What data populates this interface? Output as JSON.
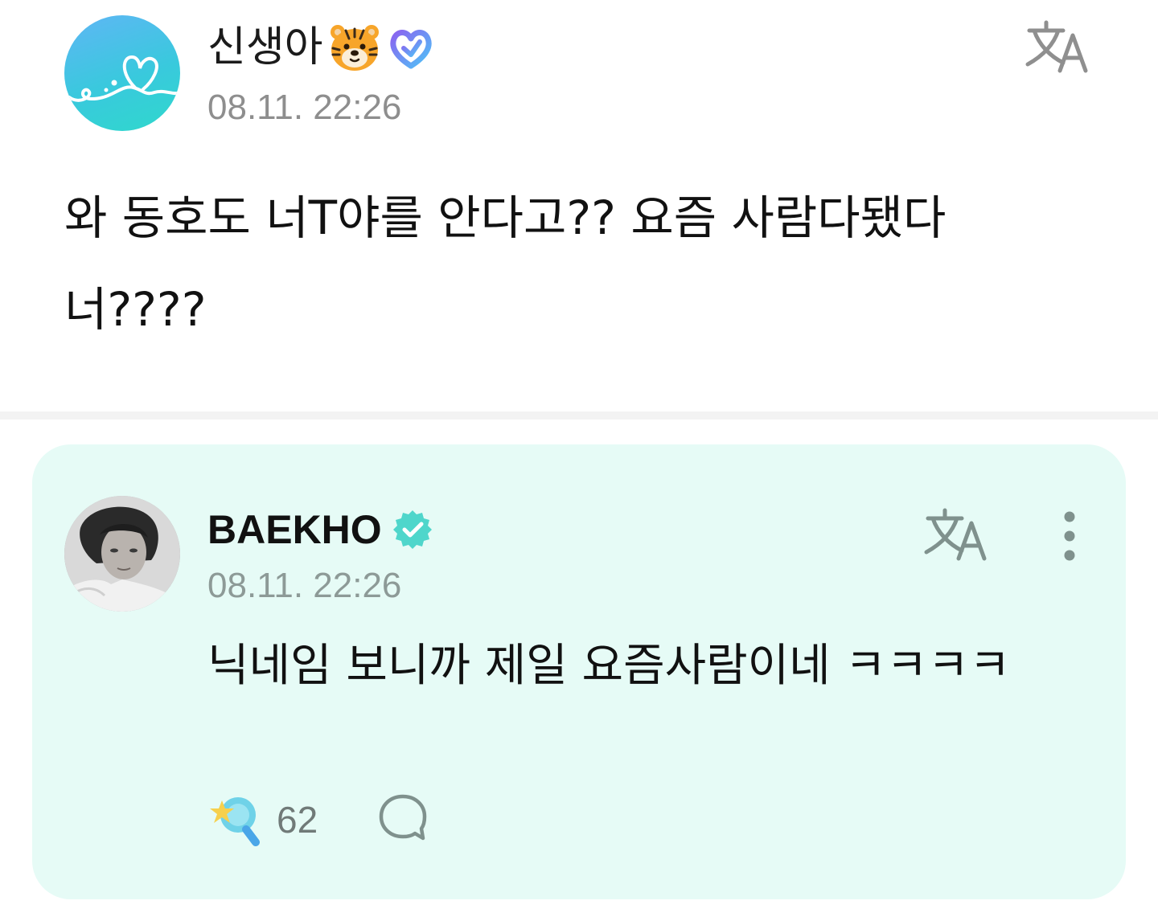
{
  "post": {
    "author_name": "신생아",
    "time": "08.11. 22:26",
    "body": "와 동호도 너T야를 안다고?? 요즘 사람다됐다 너????",
    "avatar_icon": "heart-squiggle-logo",
    "badge_icons": [
      "tiger-face-emoji",
      "membership-badge-icon"
    ]
  },
  "artist_comment": {
    "name": "BAEKHO",
    "time": "08.11. 22:26",
    "body": "닉네임 보니까 제일 요즘사람이네 ㅋㅋㅋㅋ",
    "like_count": "62",
    "icons": [
      "verified-badge-icon",
      "translate-icon",
      "more-vertical-icon",
      "lightstick-like-icon",
      "reply-bubble-icon"
    ]
  },
  "colors": {
    "card_bg": "#e6fbf6",
    "accent": "#4fd6cb",
    "timestamp": "#8e8e8e"
  }
}
